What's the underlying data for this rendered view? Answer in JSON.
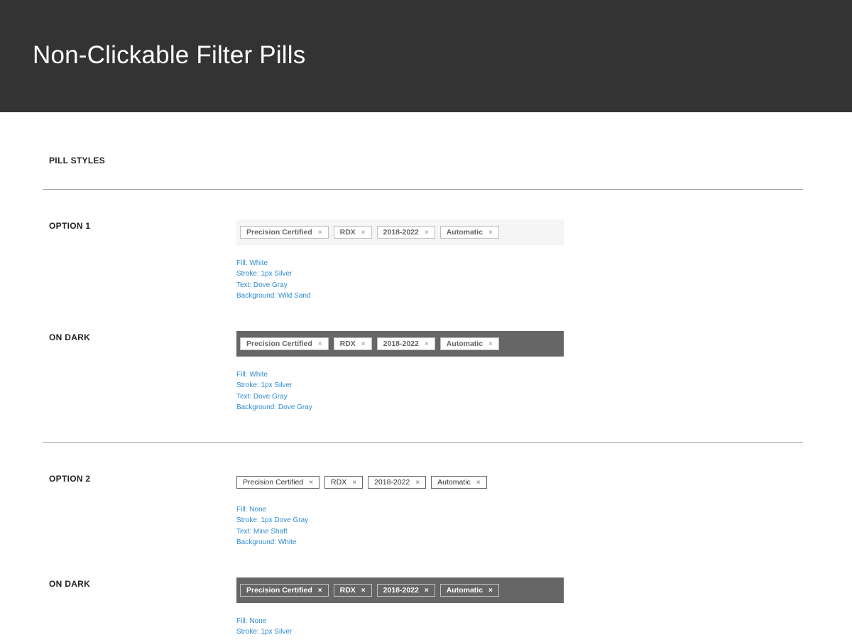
{
  "page": {
    "title": "Non-Clickable Filter Pills",
    "section_title": "PILL STYLES"
  },
  "pills": [
    {
      "label": "Precision Certified",
      "close": "×"
    },
    {
      "label": "RDX",
      "close": "×"
    },
    {
      "label": "2018-2022",
      "close": "×"
    },
    {
      "label": "Automatic",
      "close": "×"
    }
  ],
  "option1": {
    "label": "OPTION 1",
    "specs": [
      "Fill: White",
      "Stroke: 1px Silver",
      "Text: Dove Gray",
      "Background: Wild Sand"
    ]
  },
  "option1_dark": {
    "label": "ON DARK",
    "specs": [
      "Fill: White",
      "Stroke: 1px Silver",
      "Text: Dove Gray",
      "Background: Dove Gray"
    ]
  },
  "option2": {
    "label": "OPTION 2",
    "specs": [
      "Fill: None",
      "Stroke: 1px Dove Gray",
      "Text: Mine Shaft",
      "Background: White"
    ]
  },
  "option2_dark": {
    "label": "ON DARK",
    "specs": [
      "Fill: None",
      "Stroke: 1px Silver"
    ]
  },
  "colors": {
    "header_bg": "#333333",
    "wild_sand": "#f5f5f5",
    "dove_gray": "#666666",
    "silver": "#c0c0c0",
    "mine_shaft": "#333333",
    "spec_text": "#2e8bd0"
  }
}
